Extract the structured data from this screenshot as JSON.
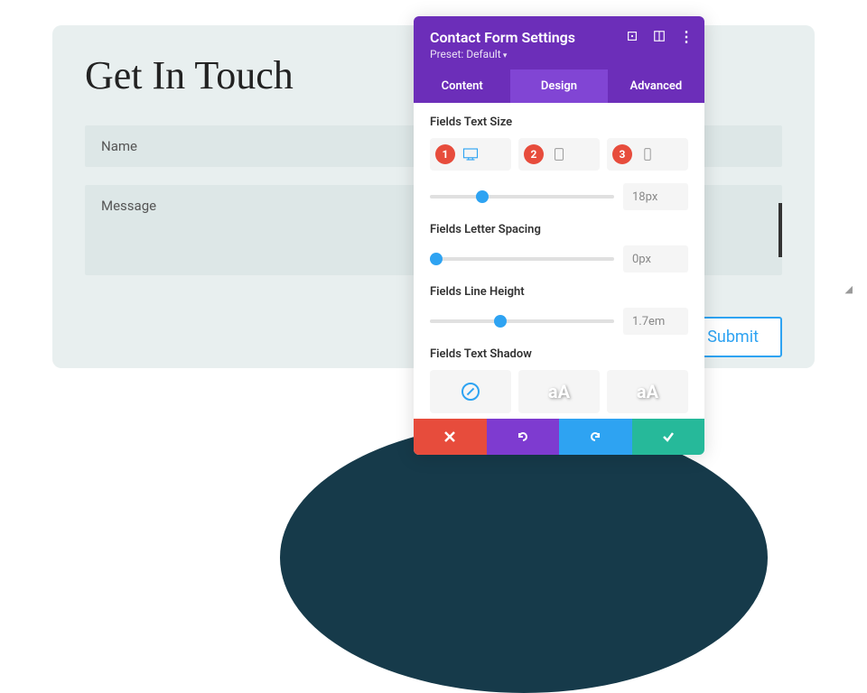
{
  "form": {
    "heading": "Get In Touch",
    "fields": {
      "name": "Name",
      "message": "Message"
    },
    "submit": "Submit"
  },
  "panel": {
    "title": "Contact Form Settings",
    "preset": "Preset: Default",
    "tabs": {
      "content": "Content",
      "design": "Design",
      "advanced": "Advanced"
    },
    "sections": {
      "textSize": {
        "label": "Fields Text Size",
        "value": "18px"
      },
      "letterSpacing": {
        "label": "Fields Letter Spacing",
        "value": "0px"
      },
      "lineHeight": {
        "label": "Fields Line Height",
        "value": "1.7em"
      },
      "textShadow": {
        "label": "Fields Text Shadow"
      }
    },
    "markers": {
      "m1": "1",
      "m2": "2",
      "m3": "3"
    },
    "shadowSample": "aA"
  }
}
